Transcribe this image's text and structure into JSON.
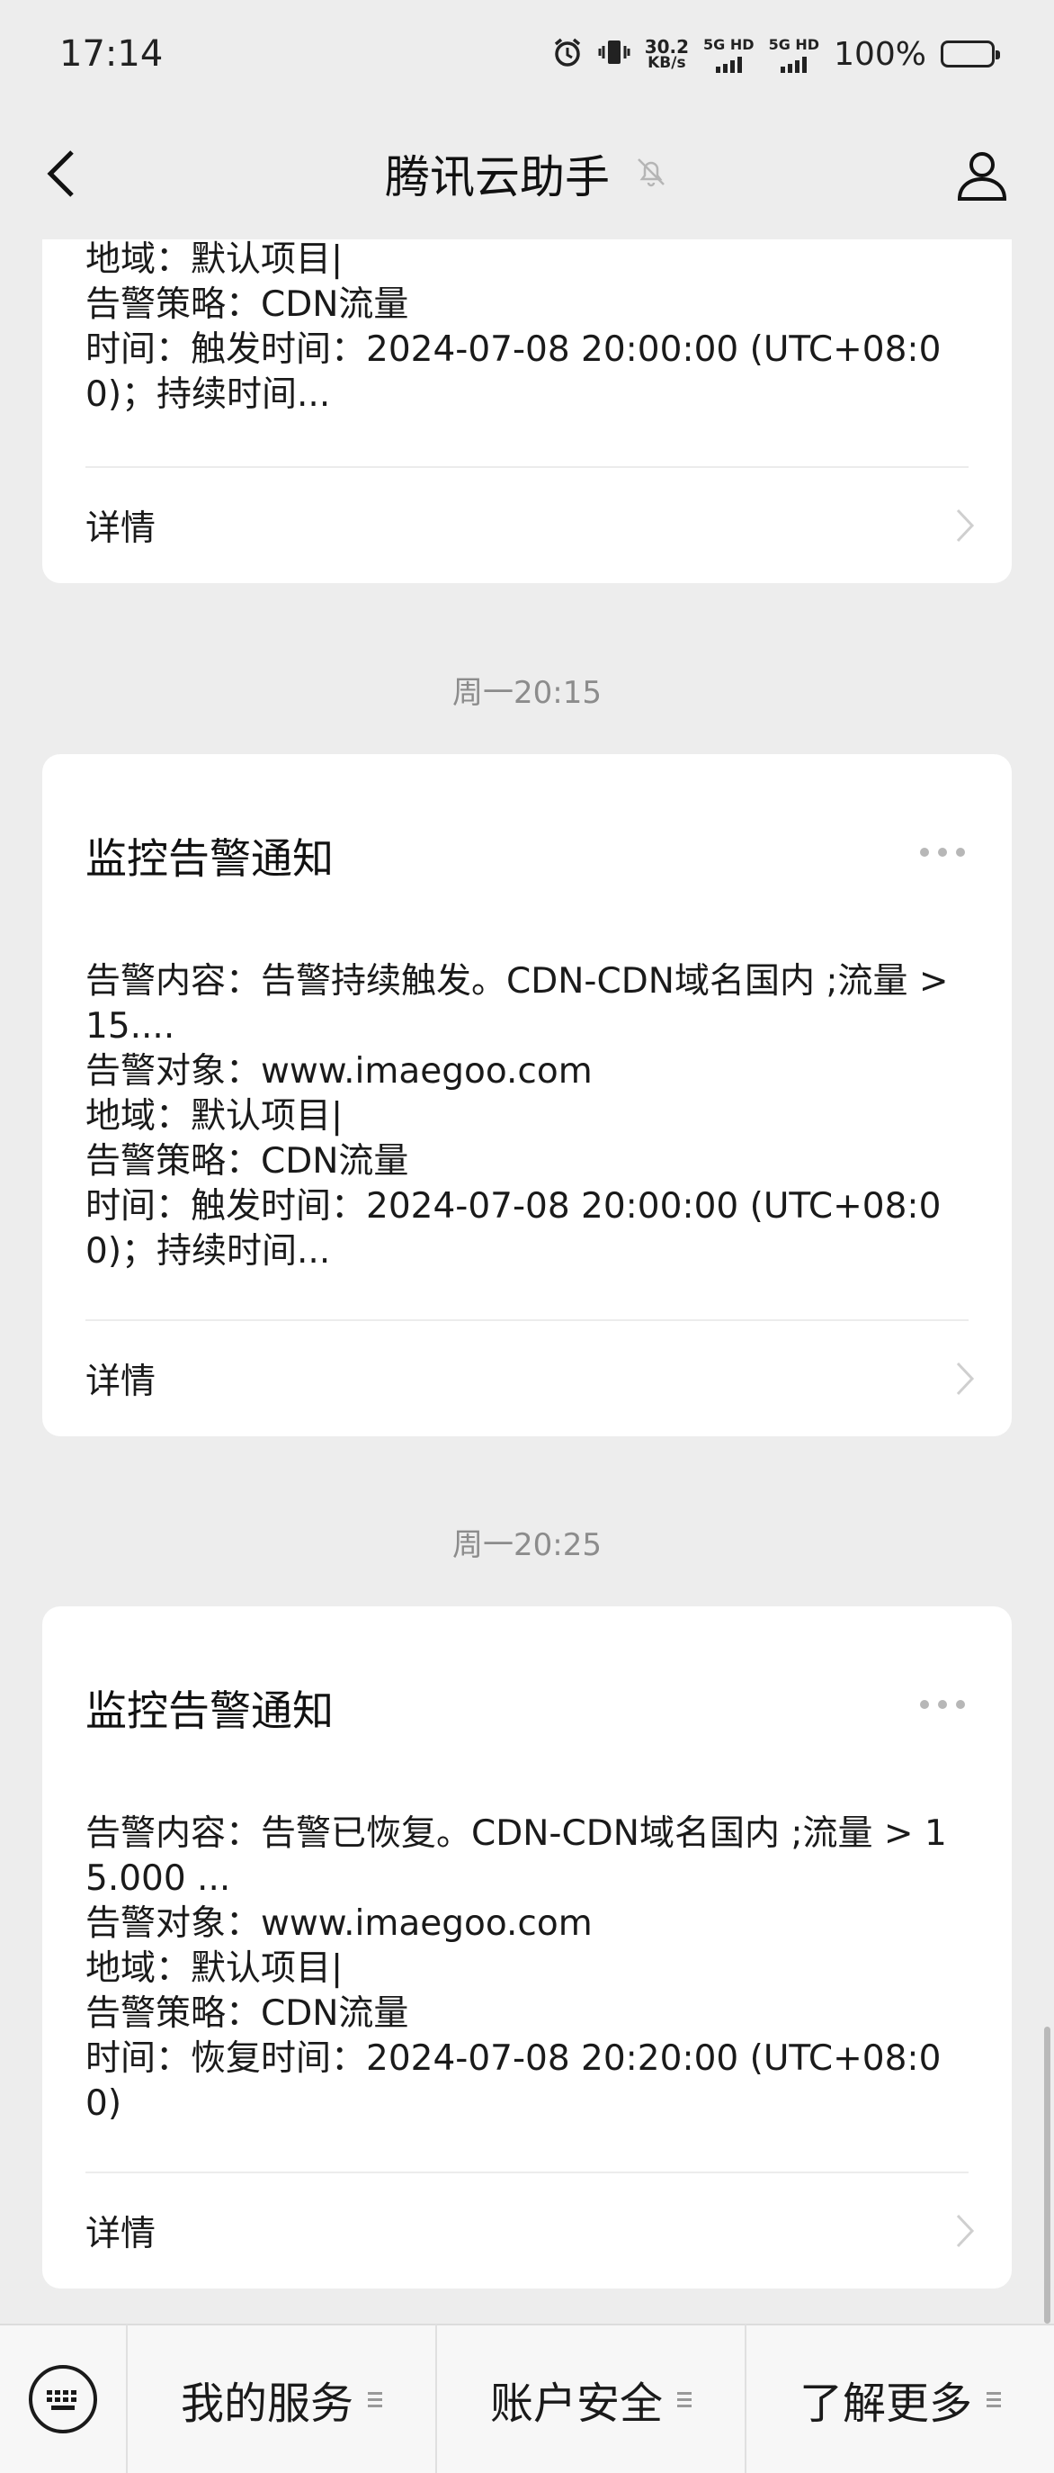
{
  "status_bar": {
    "time": "17:14",
    "net_speed": "30.2",
    "net_unit": "KB/s",
    "sim1_label": "5G HD",
    "sim2_label": "5G HD",
    "battery": "100%"
  },
  "nav": {
    "title": "腾讯云助手",
    "icons": {
      "back": "back-chevron-icon",
      "mute": "bell-muted-icon",
      "profile": "person-icon"
    }
  },
  "cards": [
    {
      "lines": [
        "地域：默认项目|",
        "告警策略：CDN流量",
        "时间：触发时间：2024-07-08 20:00:00 (UTC+08:00)；持续时间..."
      ],
      "detail_label": "详情"
    },
    {
      "timestamp": "周一20:15",
      "title": "监控告警通知",
      "lines": [
        "告警内容：告警持续触发。CDN-CDN域名国内 ;流量 > 15....",
        "告警对象：www.imaegoo.com",
        "地域：默认项目|",
        "告警策略：CDN流量",
        "时间：触发时间：2024-07-08 20:00:00 (UTC+08:00)；持续时间..."
      ],
      "detail_label": "详情"
    },
    {
      "timestamp": "周一20:25",
      "title": "监控告警通知",
      "lines": [
        "告警内容：告警已恢复。CDN-CDN域名国内 ;流量 > 15.000 ...",
        "告警对象：www.imaegoo.com",
        "地域：默认项目|",
        "告警策略：CDN流量",
        "时间：恢复时间：2024-07-08 20:20:00 (UTC+08:00)"
      ],
      "detail_label": "详情"
    }
  ],
  "bottom_menu": {
    "items": [
      "我的服务",
      "账户安全",
      "了解更多"
    ],
    "icons": {
      "keyboard": "keyboard-icon",
      "submenu": "submenu-icon"
    }
  }
}
